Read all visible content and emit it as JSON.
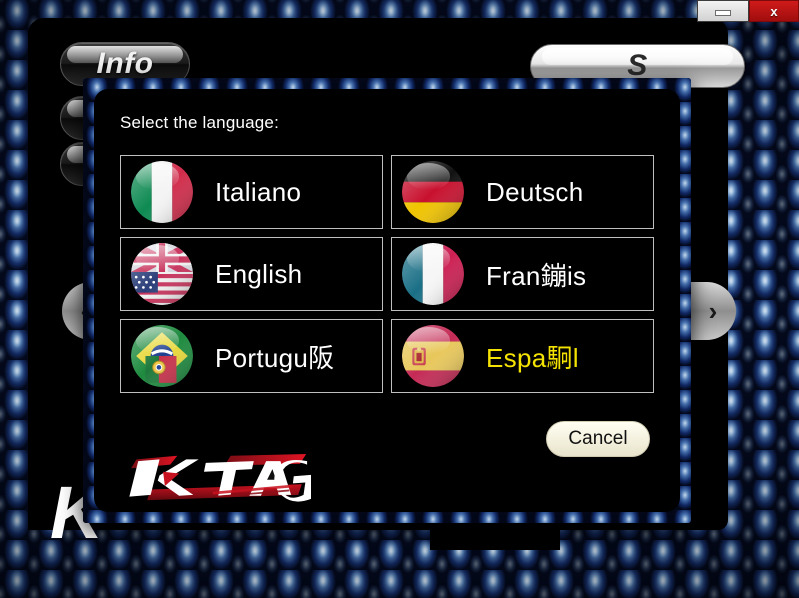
{
  "window": {
    "titlebar": {
      "minimize_label": "",
      "close_label": "x"
    }
  },
  "background": {
    "pills": [
      {
        "label": "Info"
      },
      {
        "label": ""
      },
      {
        "label": ""
      }
    ],
    "right_pill_label": "S",
    "nav_left_label": "‹",
    "nav_right_label": "›",
    "watermark_letter": "K"
  },
  "dialog": {
    "title": "Select the language:",
    "languages": [
      {
        "label": "Italiano",
        "flag": "flag-italy-icon",
        "highlight": false
      },
      {
        "label": "Deutsch",
        "flag": "flag-germany-icon",
        "highlight": false
      },
      {
        "label": "English",
        "flag": "flag-uk-us-icon",
        "highlight": false
      },
      {
        "label": "Fran鏰is",
        "flag": "flag-france-icon",
        "highlight": false
      },
      {
        "label": "Portugu阪",
        "flag": "flag-brazil-portugal-icon",
        "highlight": false
      },
      {
        "label": "Espa駉l",
        "flag": "flag-spain-icon",
        "highlight": true
      }
    ],
    "cancel_label": "Cancel",
    "logo_text": "K-TAG"
  },
  "colors": {
    "accent_yellow": "#f4e300",
    "close_red": "#c01818",
    "frame_blue": "#0a1530",
    "panel_black": "#000000"
  }
}
